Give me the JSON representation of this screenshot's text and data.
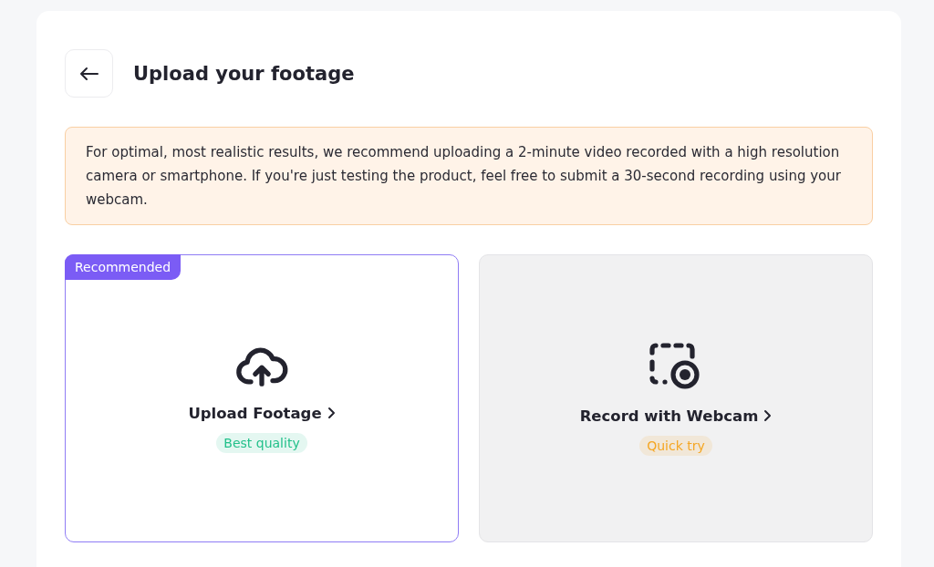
{
  "header": {
    "title": "Upload your footage"
  },
  "notice": {
    "text": "For optimal, most realistic results, we recommend uploading a 2-minute video recorded with a high resolution camera or smartphone. If you're just testing the product, feel free to submit a 30-second recording using your webcam."
  },
  "options": [
    {
      "kind": "upload",
      "badge": "Recommended",
      "label": "Upload Footage",
      "tag": "Best quality",
      "color": "#22c08a",
      "selected": true
    },
    {
      "kind": "webcam",
      "label": "Record with Webcam",
      "tag": "Quick try",
      "color": "#f5a623",
      "selected": false
    }
  ]
}
